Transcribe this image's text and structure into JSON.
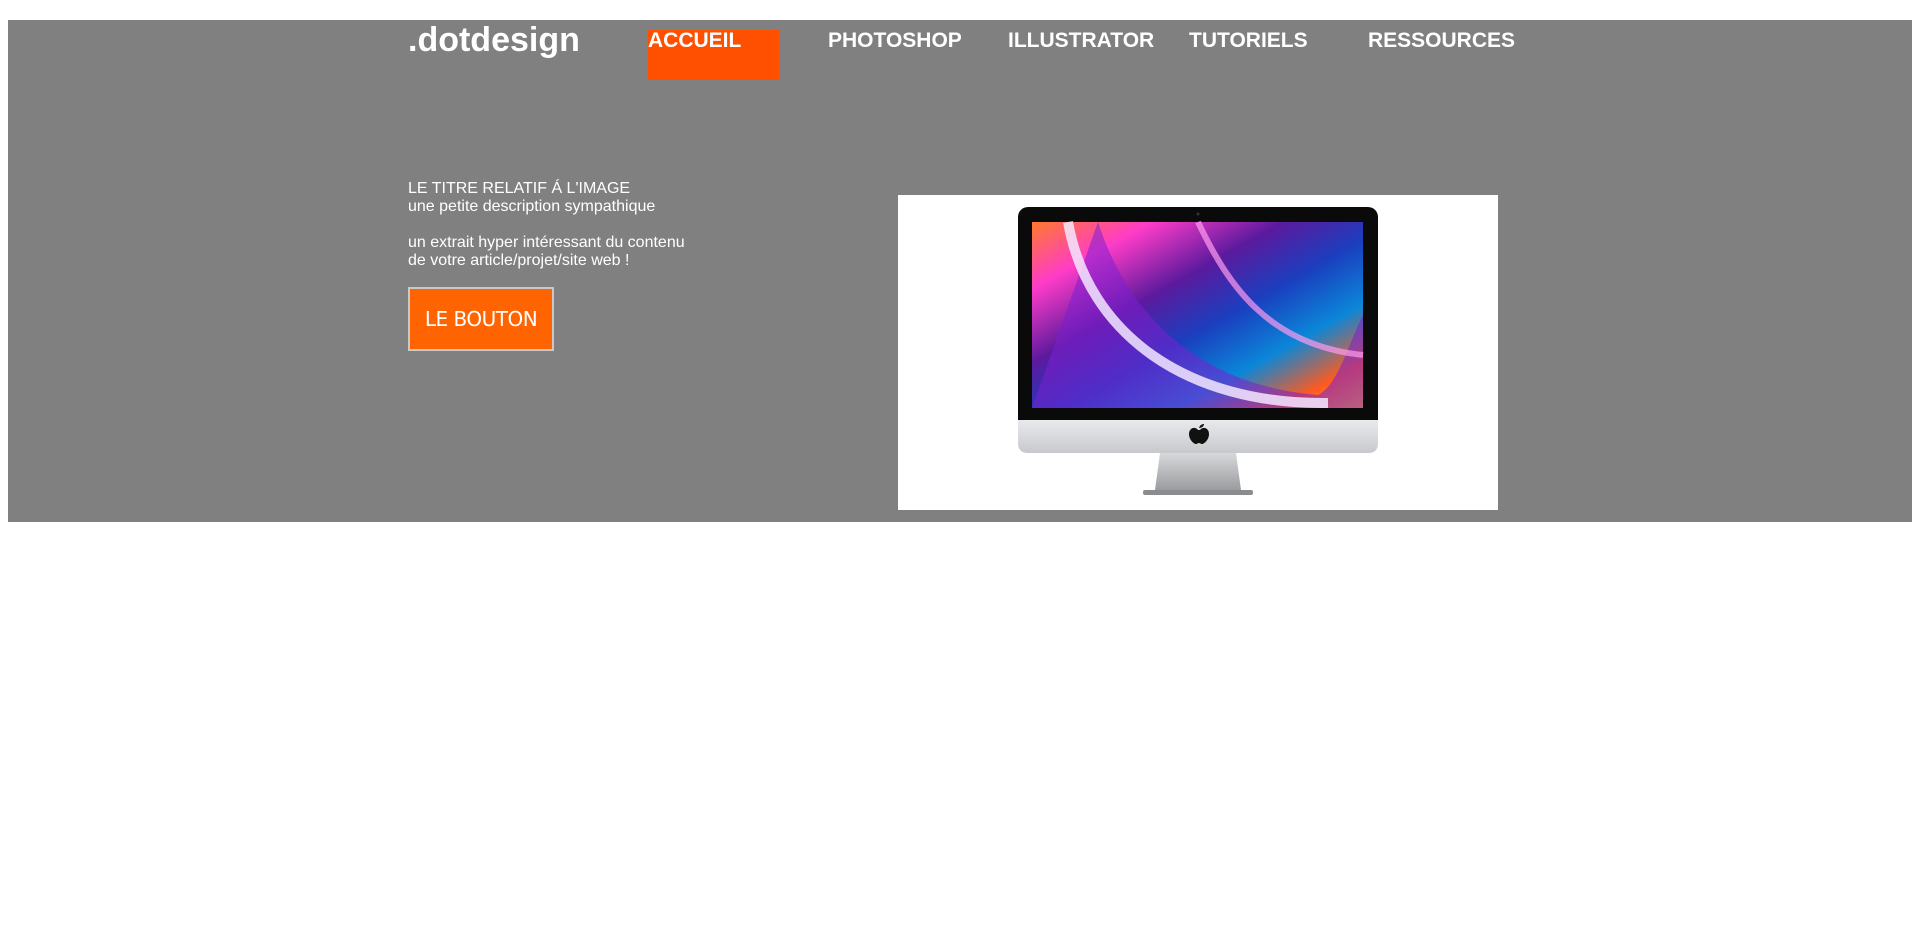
{
  "brand": {
    "logo": ".dotdesign"
  },
  "nav": {
    "items": [
      {
        "label": "ACCUEIL",
        "active": true
      },
      {
        "label": "PHOTOSHOP",
        "active": false
      },
      {
        "label": "ILLUSTRATOR",
        "active": false
      },
      {
        "label": "TUTORIELS",
        "active": false
      },
      {
        "label": "RESSOURCES",
        "active": false
      }
    ]
  },
  "hero": {
    "title": "LE TITRE RELATIF Á L'IMAGE",
    "subtitle": "une petite description sympathique",
    "excerpt_line1": "un extrait hyper intéressant du contenu",
    "excerpt_line2": "de votre article/projet/site web !",
    "button_label": "LE BOUTON"
  },
  "colors": {
    "hero_bg": "#808080",
    "accent": "#ff4f00",
    "button_bg": "#ff6400",
    "text": "#ffffff"
  },
  "icons": {
    "product_image": "imac-computer-icon",
    "brand_mark": "apple-logo-icon"
  }
}
